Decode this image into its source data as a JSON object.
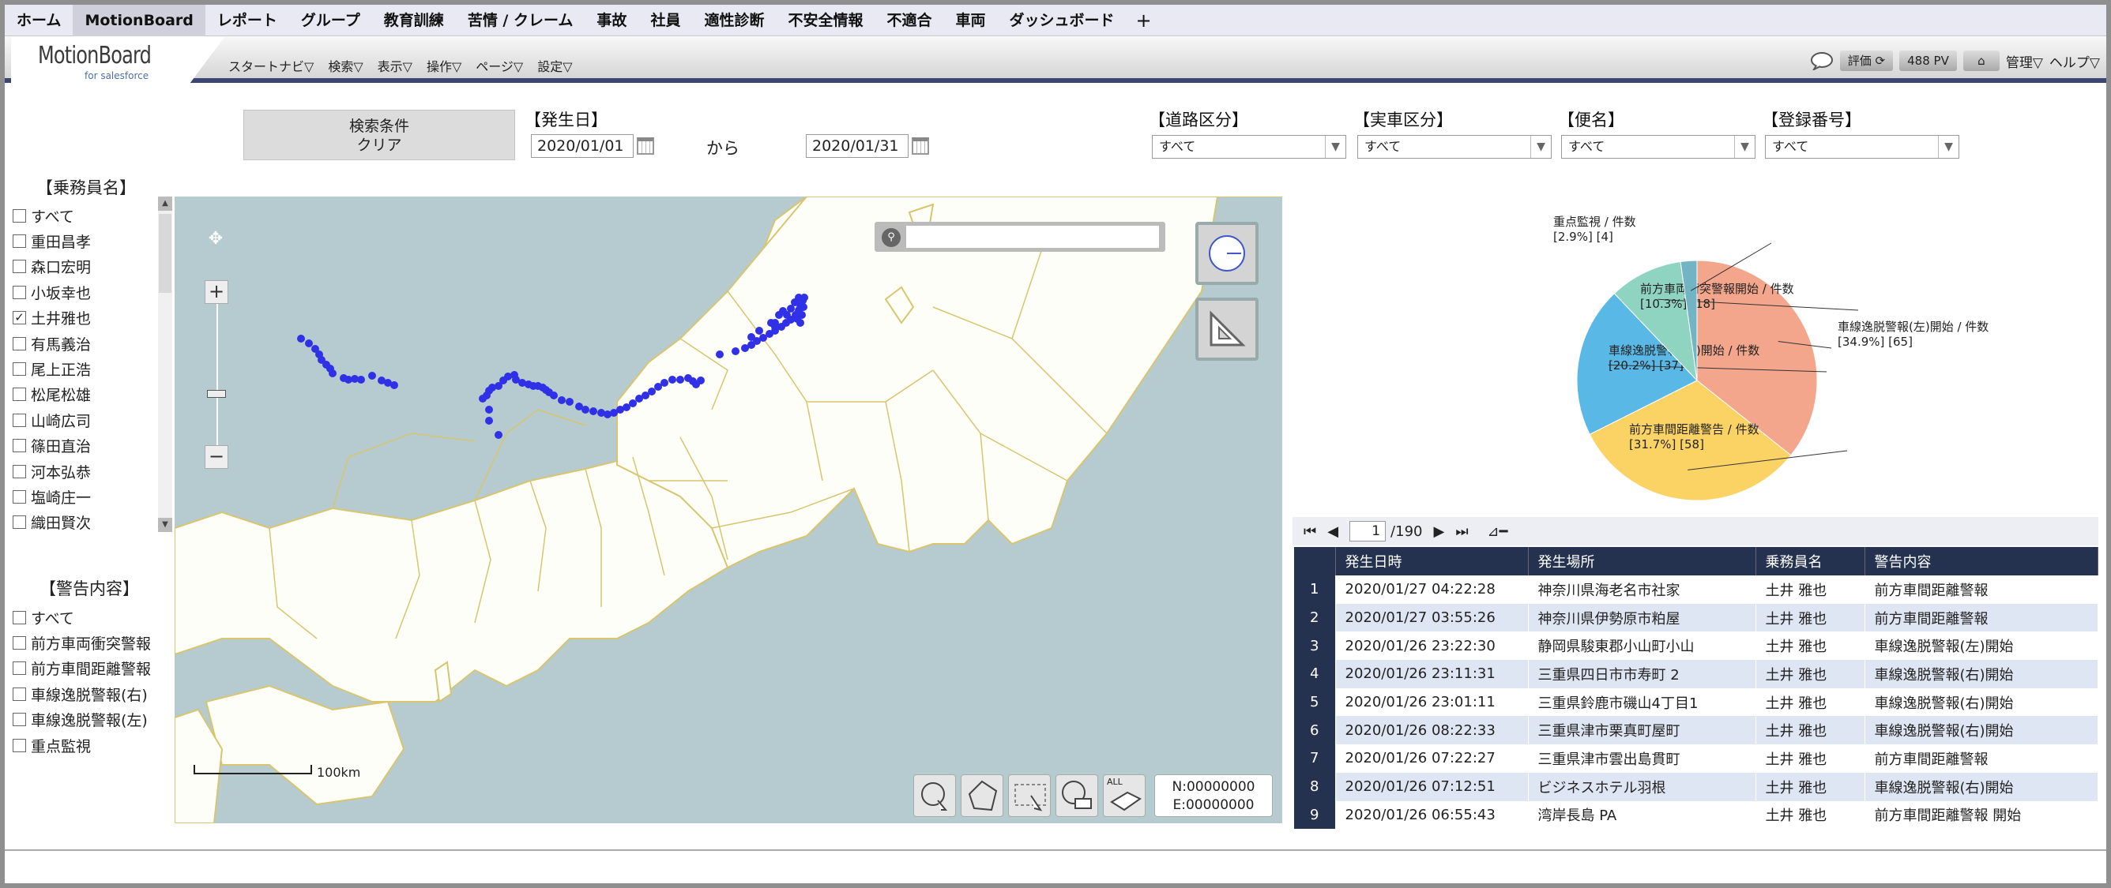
{
  "tabs": [
    "ホーム",
    "MotionBoard",
    "レポート",
    "グループ",
    "教育訓練",
    "苦情 / クレーム",
    "事故",
    "社員",
    "適性診断",
    "不安全情報",
    "不適合",
    "車両",
    "ダッシュボード",
    "+"
  ],
  "logo": {
    "title": "MotionBoard",
    "sub": "for salesforce"
  },
  "menu": [
    "スタートナビ▽",
    "検索▽",
    "表示▽",
    "操作▽",
    "ページ▽",
    "設定▽"
  ],
  "right": {
    "rate": "評価",
    "pv": "488 PV",
    "admin": "管理▽",
    "help": "ヘルプ▽"
  },
  "filters": {
    "clear_l1": "検索条件",
    "clear_l2": "クリア",
    "date_label": "【発生日】",
    "date_from": "2020/01/01",
    "kara": "から",
    "date_to": "2020/01/31",
    "road_label": "【道路区分】",
    "road": "すべて",
    "vehicle_label": "【実車区分】",
    "vehicle": "すべて",
    "bin_label": "【便名】",
    "bin": "すべて",
    "reg_label": "【登録番号】",
    "reg": "すべて"
  },
  "crew": {
    "title": "【乗務員名】",
    "items": [
      {
        "label": "すべて",
        "checked": false
      },
      {
        "label": "重田昌孝",
        "checked": false
      },
      {
        "label": "森口宏明",
        "checked": false
      },
      {
        "label": "小坂幸也",
        "checked": false
      },
      {
        "label": "土井雅也",
        "checked": true
      },
      {
        "label": "有馬義治",
        "checked": false
      },
      {
        "label": "尾上正浩",
        "checked": false
      },
      {
        "label": "松尾松雄",
        "checked": false
      },
      {
        "label": "山崎広司",
        "checked": false
      },
      {
        "label": "篠田直治",
        "checked": false
      },
      {
        "label": "河本弘恭",
        "checked": false
      },
      {
        "label": "塩崎庄一",
        "checked": false
      },
      {
        "label": "織田賢次",
        "checked": false
      }
    ]
  },
  "warn": {
    "title": "【警告内容】",
    "items": [
      {
        "label": "すべて",
        "checked": false
      },
      {
        "label": "前方車両衝突警報",
        "checked": false
      },
      {
        "label": "前方車間距離警報",
        "checked": false
      },
      {
        "label": "車線逸脱警報(右)",
        "checked": false
      },
      {
        "label": "車線逸脱警報(左)",
        "checked": false
      },
      {
        "label": "重点監視",
        "checked": false
      }
    ]
  },
  "map": {
    "scale": "100km",
    "north": "N:00000000",
    "east": "E:00000000",
    "all": "ALL",
    "track": [
      [
        160,
        180
      ],
      [
        170,
        186
      ],
      [
        178,
        193
      ],
      [
        183,
        200
      ],
      [
        186,
        207
      ],
      [
        192,
        213
      ],
      [
        197,
        218
      ],
      [
        200,
        224
      ],
      [
        214,
        230
      ],
      [
        220,
        232
      ],
      [
        228,
        231
      ],
      [
        236,
        232
      ],
      [
        250,
        227
      ],
      [
        262,
        233
      ],
      [
        270,
        236
      ],
      [
        278,
        239
      ],
      [
        395,
        252
      ],
      [
        390,
        256
      ],
      [
        398,
        246
      ],
      [
        402,
        242
      ],
      [
        410,
        240
      ],
      [
        416,
        233
      ],
      [
        422,
        228
      ],
      [
        430,
        226
      ],
      [
        432,
        232
      ],
      [
        440,
        236
      ],
      [
        448,
        238
      ],
      [
        454,
        240
      ],
      [
        460,
        240
      ],
      [
        466,
        242
      ],
      [
        470,
        245
      ],
      [
        474,
        248
      ],
      [
        480,
        252
      ],
      [
        490,
        258
      ],
      [
        500,
        260
      ],
      [
        512,
        266
      ],
      [
        520,
        270
      ],
      [
        530,
        272
      ],
      [
        540,
        274
      ],
      [
        548,
        276
      ],
      [
        556,
        274
      ],
      [
        564,
        270
      ],
      [
        572,
        267
      ],
      [
        580,
        262
      ],
      [
        588,
        256
      ],
      [
        596,
        252
      ],
      [
        604,
        247
      ],
      [
        612,
        241
      ],
      [
        620,
        236
      ],
      [
        630,
        232
      ],
      [
        640,
        232
      ],
      [
        650,
        230
      ],
      [
        656,
        234
      ],
      [
        660,
        238
      ],
      [
        666,
        233
      ],
      [
        398,
        270
      ],
      [
        398,
        284
      ],
      [
        410,
        302
      ],
      [
        690,
        200
      ],
      [
        710,
        196
      ],
      [
        722,
        192
      ],
      [
        730,
        188
      ],
      [
        737,
        183
      ],
      [
        745,
        179
      ],
      [
        753,
        174
      ],
      [
        760,
        170
      ],
      [
        768,
        165
      ],
      [
        774,
        160
      ],
      [
        780,
        156
      ],
      [
        786,
        150
      ],
      [
        790,
        144
      ],
      [
        792,
        138
      ],
      [
        795,
        132
      ],
      [
        788,
        155
      ],
      [
        792,
        160
      ],
      [
        794,
        150
      ],
      [
        796,
        140
      ],
      [
        797,
        128
      ],
      [
        790,
        128
      ],
      [
        785,
        134
      ],
      [
        780,
        142
      ],
      [
        775,
        150
      ],
      [
        770,
        145
      ],
      [
        765,
        150
      ],
      [
        760,
        160
      ],
      [
        755,
        160
      ],
      [
        760,
        165
      ],
      [
        740,
        170
      ],
      [
        730,
        178
      ]
    ]
  },
  "chart_data": {
    "type": "pie",
    "slices": [
      {
        "label": "車線逸脱警報(左)開始 / 件数",
        "pct": "[34.9%]",
        "count": "[65]",
        "value": 65,
        "color": "#f4a68c"
      },
      {
        "label": "前方車間距離警告 / 件数",
        "pct": "[31.7%]",
        "count": "[58]",
        "value": 58,
        "color": "#fbd264"
      },
      {
        "label": "車線逸脱警報(右)開始 / 件数",
        "pct": "[20.2%]",
        "count": "[37]",
        "value": 37,
        "color": "#5ab8e6"
      },
      {
        "label": "前方車両衝突警報開始 / 件数",
        "pct": "[10.3%]",
        "count": "[18]",
        "value": 18,
        "color": "#8fd4c0"
      },
      {
        "label": "重点監視 / 件数",
        "pct": "[2.9%]",
        "count": "[4]",
        "value": 4,
        "color": "#72b4c4"
      }
    ]
  },
  "pager": {
    "page": "1",
    "total": "/190"
  },
  "table": {
    "headers": [
      "",
      "発生日時",
      "発生場所",
      "乗務員名",
      "警告内容"
    ],
    "rows": [
      [
        "1",
        "2020/01/27 04:22:28",
        "神奈川県海老名市社家",
        "土井 雅也",
        "前方車間距離警報"
      ],
      [
        "2",
        "2020/01/27 03:55:26",
        "神奈川県伊勢原市粕屋",
        "土井 雅也",
        "前方車間距離警報"
      ],
      [
        "3",
        "2020/01/26 23:22:30",
        "静岡県駿東郡小山町小山",
        "土井 雅也",
        "車線逸脱警報(左)開始"
      ],
      [
        "4",
        "2020/01/26 23:11:31",
        "三重県四日市市寿町 2",
        "土井 雅也",
        "車線逸脱警報(右)開始"
      ],
      [
        "5",
        "2020/01/26 23:01:11",
        "三重県鈴鹿市磯山4丁目1",
        "土井 雅也",
        "車線逸脱警報(右)開始"
      ],
      [
        "6",
        "2020/01/26 08:22:33",
        "三重県津市栗真町屋町",
        "土井 雅也",
        "車線逸脱警報(右)開始"
      ],
      [
        "7",
        "2020/01/26 07:22:27",
        "三重県津市雲出島貫町",
        "土井 雅也",
        "前方車間距離警報"
      ],
      [
        "8",
        "2020/01/26 07:12:51",
        "ビジネスホテル羽根",
        "土井 雅也",
        "車線逸脱警報(右)開始"
      ],
      [
        "9",
        "2020/01/26 06:55:43",
        "湾岸長島 PA",
        "土井 雅也",
        "前方車間距離警報 開始"
      ]
    ]
  }
}
